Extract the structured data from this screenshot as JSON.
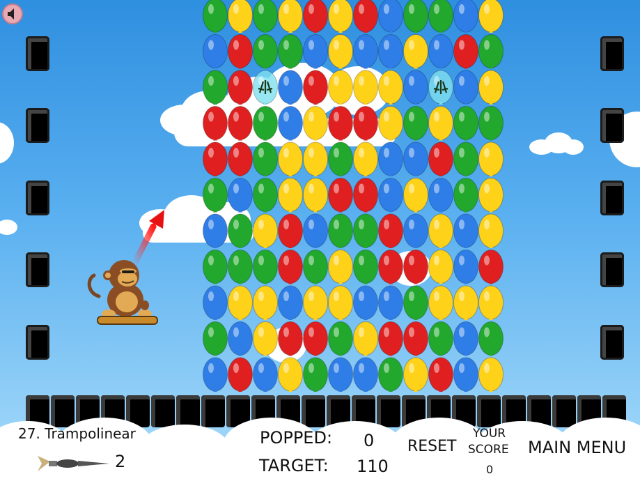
{
  "level": {
    "number_name": "27. Trampolinear"
  },
  "hud": {
    "popped_label": "POPPED:",
    "popped_value": "0",
    "target_label": "TARGET:",
    "target_value": "110",
    "reset_label": "RESET",
    "your_score_line1": "YOUR",
    "your_score_line2": "SCORE",
    "score_value": "0",
    "main_menu_label": "MAIN MENU",
    "darts_remaining": "2"
  },
  "icons": {
    "sound": "speaker-icon",
    "dart": "dart-icon",
    "monkey": "monkey-icon",
    "aim": "aim-arrow-icon"
  },
  "colors": {
    "red": "#e02020",
    "blue": "#2f7ee8",
    "green": "#22a82c",
    "yellow": "#ffd21a",
    "special": "#7fe0f0"
  },
  "balloon_grid": [
    "GYGYRYRBGGBY",
    "BRGGBYBBYBRG",
    "GRSBRYYYBSBY",
    "RRGBYRRYGYGG",
    "RRGYYGYBBRGY",
    "GBGYYRRBYBGY",
    "BGYRBGGRBYBY",
    "GGGRGYGRRYBR",
    "BYYBYYBBGYYY",
    "GBYRRGYRRGBG",
    "BRBYGBBGYRBY"
  ]
}
